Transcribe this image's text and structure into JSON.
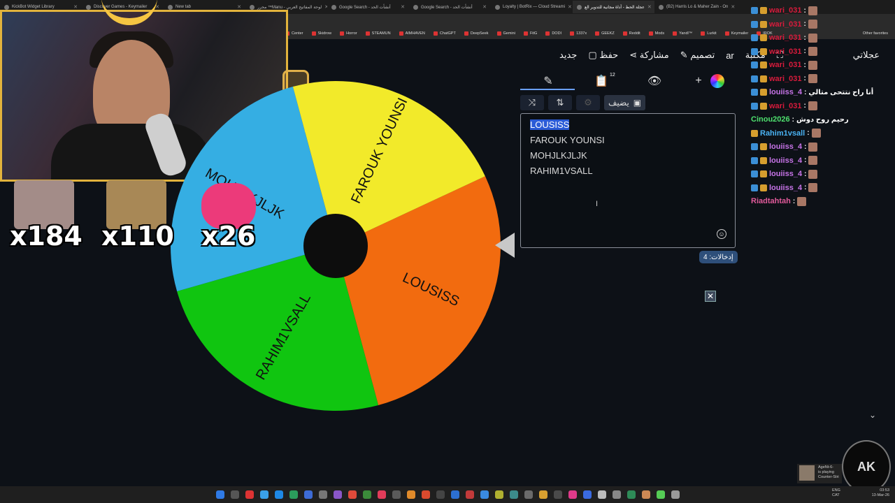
{
  "browser": {
    "tabs": [
      {
        "label": "KickBot Widget Library"
      },
      {
        "label": "Discover Games - Keymailer"
      },
      {
        "label": "New tab"
      },
      {
        "label": "محرر ™Manu - لوحة المفاتيح العربي"
      },
      {
        "label": "Google Search - أنشأت الحد"
      },
      {
        "label": "Google Search - أنشأت الحد"
      },
      {
        "label": "Loyalty | BotRix — Cloud Streami"
      },
      {
        "label": "عجلة الحظ - أداة مجانية للتدوير الع"
      },
      {
        "label": "(B2) Harris Lo & Maher Zain - On"
      }
    ],
    "bookmarks": [
      "Center",
      "Skidrow",
      "Horror",
      "STEAMUN",
      "AIMHAVEN",
      "ChatGPT",
      "DeepSeek",
      "Gemini",
      "FitG",
      "DODI",
      "1337x",
      "GEEKZ",
      "Reddit",
      "Mods",
      "Yandl™",
      "Lurkit",
      "Keymailer",
      "IROK"
    ],
    "other_favorites": "Other favorites"
  },
  "top_menu": {
    "new": "جديد",
    "save": "حفظ",
    "share": "مشاركة",
    "design": "تصميم",
    "lang": "ar",
    "gallery": "مكتبة",
    "wheel_label": "عجلاتي"
  },
  "stickers": {
    "count1": "x184",
    "count2": "x110",
    "count3": "x26"
  },
  "wheel": {
    "segments": [
      {
        "label": "LOUSISS",
        "color": "#f26b0f"
      },
      {
        "label": "RAHIM1VSALL",
        "color": "#10c510"
      },
      {
        "label": "MOHJLKJLJK",
        "color": "#35aee3"
      },
      {
        "label": "FAROUK YOUNSI",
        "color": "#f2ea2a"
      }
    ]
  },
  "editor": {
    "clipboard_badge": "12",
    "add_image_label": "يضيف",
    "entries": [
      "LOUSISS",
      "FAROUK YOUNSI",
      "MOHJLKJLJK",
      "RAHIM1VSALL"
    ],
    "entries_count": "إدخالات: 4"
  },
  "chat": [
    {
      "user": "wari_031",
      "color": "#d81b3c",
      "text": "",
      "icons": [
        "b",
        "c"
      ]
    },
    {
      "user": "wari_031",
      "color": "#d81b3c",
      "text": "",
      "icons": [
        "b",
        "c"
      ]
    },
    {
      "user": "wari_031",
      "color": "#d81b3c",
      "text": "",
      "icons": [
        "b",
        "c"
      ]
    },
    {
      "user": "wari_031",
      "color": "#d81b3c",
      "text": "",
      "icons": [
        "b",
        "c"
      ]
    },
    {
      "user": "wari_031",
      "color": "#d81b3c",
      "text": "",
      "icons": [
        "b",
        "c"
      ]
    },
    {
      "user": "wari_031",
      "color": "#d81b3c",
      "text": "",
      "icons": [
        "b",
        "c"
      ]
    },
    {
      "user": "louiiss_4",
      "color": "#c774e8",
      "text": "أنا راح نتتحى متالي",
      "icons": [
        "b",
        "c"
      ]
    },
    {
      "user": "wari_031",
      "color": "#d81b3c",
      "text": "",
      "icons": [
        "b",
        "c"
      ]
    },
    {
      "user": "Cinou2026",
      "color": "#4ee06e",
      "text": "رحيم روح دوش",
      "icons": []
    },
    {
      "user": "Rahim1vsall",
      "color": "#4ab3f4",
      "text": "",
      "icons": [
        "c"
      ]
    },
    {
      "user": "louiiss_4",
      "color": "#c774e8",
      "text": "",
      "icons": [
        "b",
        "c"
      ]
    },
    {
      "user": "louiiss_4",
      "color": "#c774e8",
      "text": "",
      "icons": [
        "b",
        "c"
      ]
    },
    {
      "user": "louiiss_4",
      "color": "#c774e8",
      "text": "",
      "icons": [
        "b",
        "c"
      ]
    },
    {
      "user": "louiiss_4",
      "color": "#c774e8",
      "text": "",
      "icons": [
        "b",
        "c"
      ]
    },
    {
      "user": "Riadtahtah",
      "color": "#e05a9a",
      "text": "",
      "icons": []
    }
  ],
  "game_notification": {
    "name": "AgeNt-6-",
    "status": "is playing",
    "game": "Counter-Stri"
  },
  "taskbar": {
    "lang": "ENG",
    "region": "CAT",
    "time": "03:53",
    "date": "13-Mar-26"
  }
}
